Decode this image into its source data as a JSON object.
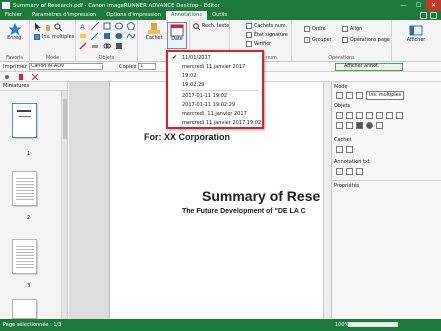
{
  "window": {
    "title": "Summary of Research.pdf - Canon imageRUNNER ADVANCE Desktop - Editor",
    "min": "—",
    "max": "☐",
    "close": "✕"
  },
  "tabs": [
    "Fichier",
    "Paramètres d'impression",
    "Options d'impression",
    "Annotations",
    "Outils"
  ],
  "ribbon": {
    "enreg_label": "Enreg.",
    "favoris_label": "Favoris",
    "mode_label": "Mode",
    "ins_multiples": "Ins. multiples",
    "objets_label": "Objets",
    "cachet_label": "Cachet",
    "date_label": "Date",
    "rech_texte": "Rech. texte",
    "dess_label": "Dess.",
    "cachets_num": "Cachets num.",
    "etat_signature": "État signature",
    "verifier": "Vérifier",
    "sign_num": "Sign. num.",
    "ordre": "Ordre",
    "grouper": "Grouper",
    "aligner": "Align",
    "ops_page": "Opérations page",
    "operations_label": "Opérations",
    "afficher": "Afficher",
    "afficher_annot": "Afficher annot."
  },
  "toolbar": {
    "imprimer_label": "Imprimer :",
    "printer_value": "Canon iR-ADV",
    "copies_label": "Copies",
    "copies_value": "1"
  },
  "left_panel": {
    "title": "Miniatures",
    "pages": [
      "1",
      "2",
      "3"
    ]
  },
  "document": {
    "for_line": "For: XX Corporation",
    "heading": "Summary of Rese",
    "subheading": "The Future Development of \"DE LA C"
  },
  "date_dropdown": {
    "selected": "11/01/2017",
    "items": [
      "11/01/2017",
      "mercredi 11 janvier 2017",
      "19:02",
      "19:02:29",
      "2017-01-11 19:02",
      "2017-01-11 19:02:29",
      "mercredi, 11 janvier 2017",
      "mercredi 11 janvier 2017 19:02"
    ],
    "check": "✔"
  },
  "right_panel": {
    "mode_title": "Mode",
    "ins_multiples": "Ins. multiples",
    "objets_title": "Objets",
    "cachet_title": "Cachet",
    "annotation_title": "Annotation txt",
    "proprietes_title": "Propriétés",
    "afficher_annot": "Afficher annot."
  },
  "status": {
    "page_info": "Page sélectionnée : 1/3",
    "zoom": "100%"
  },
  "colors": {
    "brand_green": "#1e7a3c",
    "highlight_red": "#d9202e"
  }
}
